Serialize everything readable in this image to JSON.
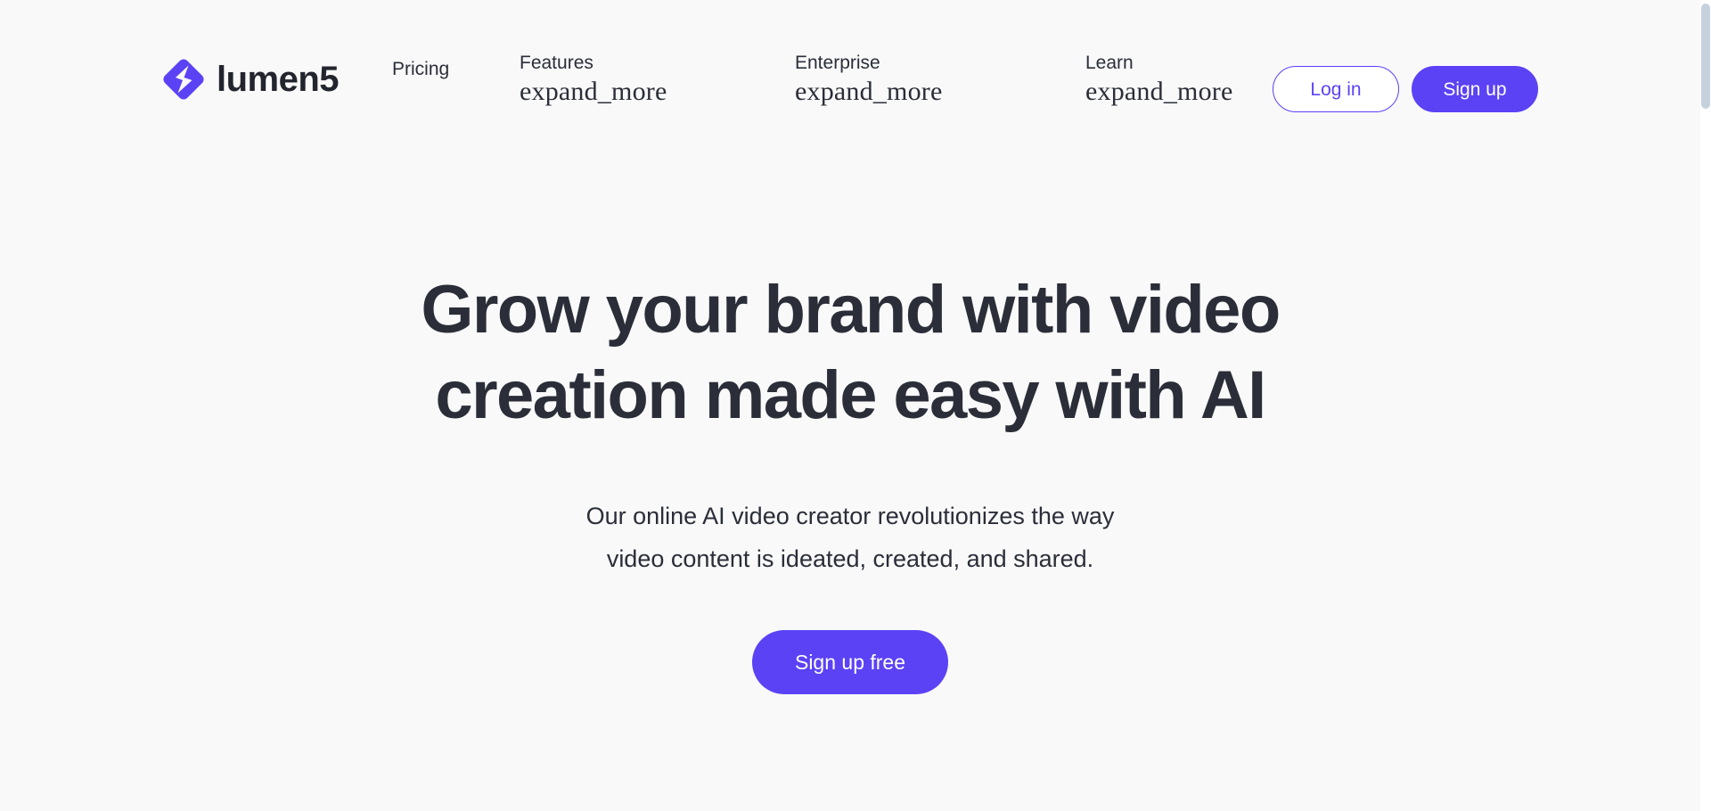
{
  "theme": {
    "background": "#f9f9fa",
    "accent": "#5b42f5",
    "text_dark": "#2b2e38",
    "scrollbar_thumb": "#c6d1de"
  },
  "header": {
    "brand": {
      "logo_icon": "lumen5-diamond-bolt-logo",
      "name": "lumen5"
    },
    "nav": [
      {
        "label": "Pricing",
        "type": "link",
        "icon": null
      },
      {
        "label": "Features",
        "type": "dropdown",
        "icon": "expand_more"
      },
      {
        "label": "Enterprise",
        "type": "dropdown",
        "icon": "expand_more"
      },
      {
        "label": "Learn",
        "type": "dropdown",
        "icon": "expand_more"
      }
    ],
    "actions": {
      "login_label": "Log in",
      "signup_label": "Sign up"
    }
  },
  "hero": {
    "title_line_1": "Grow your brand with video",
    "title_line_2": "creation made easy with AI",
    "subtitle_line_1": "Our online AI video creator revolutionizes the way",
    "subtitle_line_2": "video content is ideated, created, and shared.",
    "cta_label": "Sign up free"
  },
  "scrollbar": {
    "orientation": "vertical",
    "position": "top"
  }
}
